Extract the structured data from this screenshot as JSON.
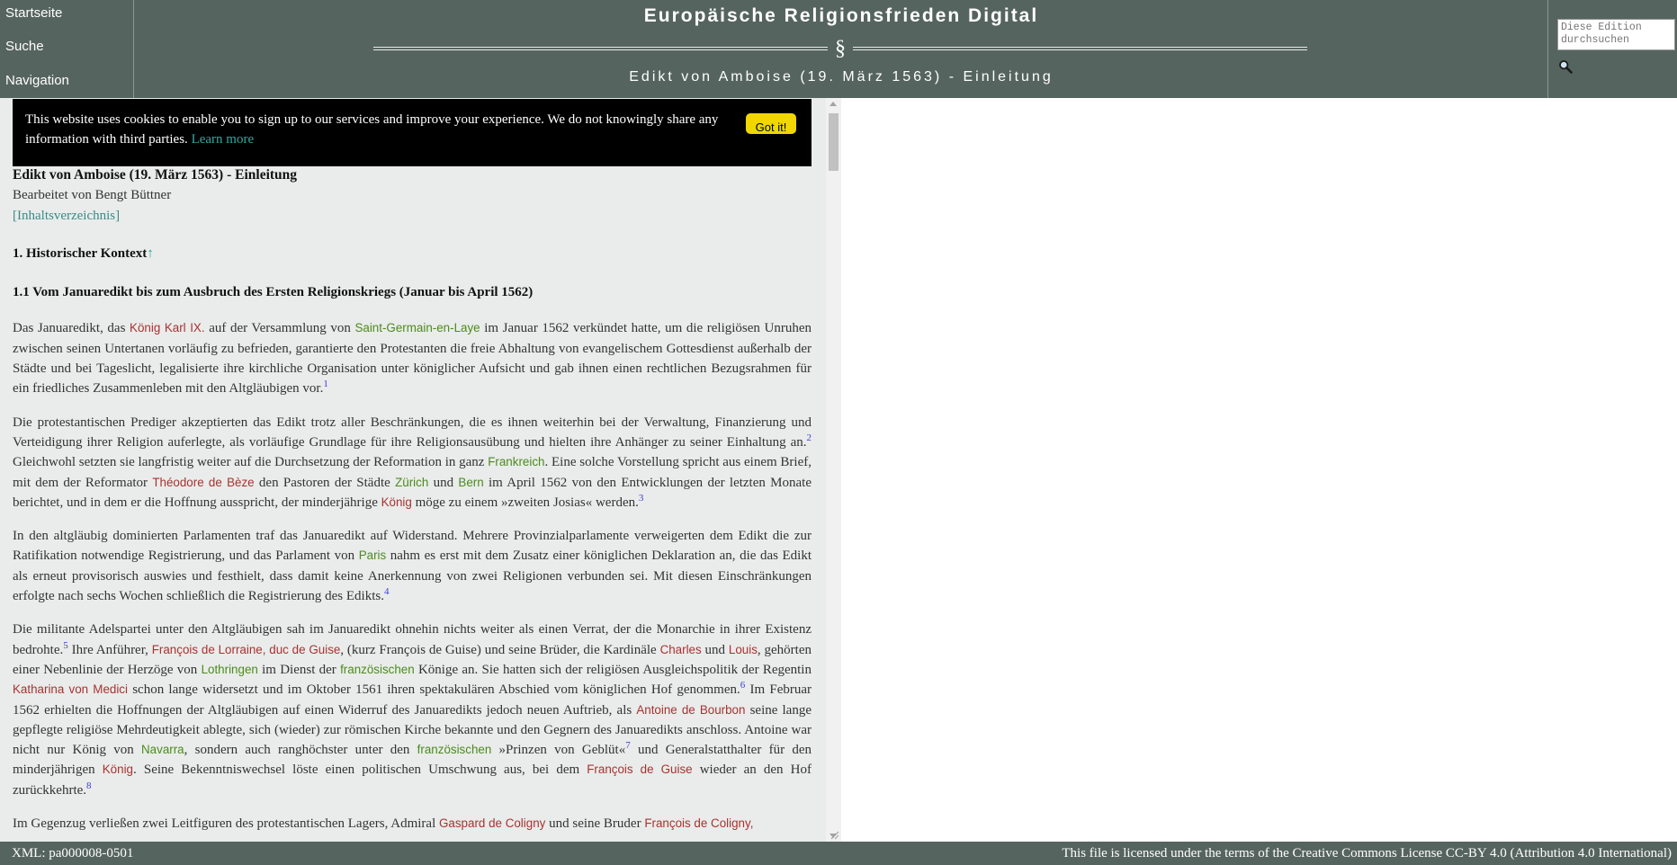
{
  "header": {
    "nav": {
      "home": "Startseite",
      "search": "Suche",
      "navigation": "Navigation"
    },
    "site_title": "Europäische Religionsfrieden Digital",
    "ornament": "§",
    "subtitle": "Edikt von Amboise (19. März 1563) - Einleitung",
    "search_placeholder": "Diese Edition durchsuchen"
  },
  "cookie_banner": {
    "text": "This website uses cookies to enable you to sign up to our services and improve your experience. We do not knowingly share any information with third parties.",
    "learn_more": "Learn more",
    "button": "Got it!"
  },
  "document": {
    "title": "Edikt von Amboise (19. März 1563) - Einleitung",
    "byline": "Bearbeitet von Bengt Büttner",
    "toc": "[Inhaltsverzeichnis]",
    "section_1": "1. Historischer Kontext",
    "section_1_arrow": "↑",
    "section_1_1": "1.1 Vom Januaredikt bis zum Ausbruch des Ersten Religionskriegs (Januar bis April 1562)",
    "paragraphs": [
      {
        "t0": "Das Januaredikt, das ",
        "p0": "König Karl IX.",
        "t1": " auf der Versammlung von ",
        "l0": "Saint-Germain-en-Laye",
        "t2": " im Januar 1562 verkündet hatte, um die religiösen Unruhen zwischen seinen Untertanen vorläufig zu befrieden, garantierte den Protestanten die freie Abhaltung von evangelischem Gottesdienst außerhalb der Städte und bei Tageslicht, legalisierte ihre kirchliche Organisation unter königlicher Aufsicht und gab ihnen einen rechtlichen Bezugsrahmen für ein friedliches Zusammenleben mit den Altgläubigen vor.",
        "f0": "1"
      },
      {
        "t0": "Die protestantischen Prediger akzeptierten das Edikt trotz aller Beschränkungen, die es ihnen weiterhin bei der Verwaltung, Finanzierung und Verteidigung ihrer Religion auferlegte, als vorläufige Grundlage für ihre Religionsausübung und hielten ihre Anhänger zu seiner Einhaltung an.",
        "f0": "2",
        "t1": " Gleichwohl setzten sie langfristig weiter auf die Durchsetzung der Reformation in ganz ",
        "l0": "Frankreich",
        "t2": ". Eine solche Vorstellung spricht aus einem Brief, mit dem der Reformator ",
        "p0": "Théodore de Bèze",
        "t3": " den Pastoren der Städte ",
        "l1": "Zürich",
        "t4": " und ",
        "l2": "Bern",
        "t5": " im April 1562 von den Entwicklungen der letzten Monate berichtet, und in dem er die Hoffnung ausspricht, der minderjährige ",
        "p1": "König",
        "t6": " möge zu einem »zweiten Josias« werden.",
        "f1": "3"
      },
      {
        "t0": "In den altgläubig dominierten Parlamenten traf das Januaredikt auf Widerstand. Mehrere Provinzialparlamente verweigerten dem Edikt die zur Ratifikation notwendige Registrierung, und das Parlament von ",
        "l0": "Paris",
        "t1": " nahm es erst mit dem Zusatz einer königlichen Deklaration an, die das Edikt als erneut provisorisch auswies und festhielt, dass damit keine Anerkennung von zwei Religionen verbunden sei. Mit diesen Einschränkungen erfolgte nach sechs Wochen schließlich die Registrierung des Edikts.",
        "f0": "4"
      },
      {
        "t0": "Die militante Adelspartei unter den Altgläubigen sah im Januaredikt ohnehin nichts weiter als einen Verrat, der die Monarchie in ihrer Existenz bedrohte.",
        "f0": "5",
        "t1": " Ihre Anführer, ",
        "p0": "François de Lorraine, duc de Guise",
        "t2": ", (kurz François de Guise) und seine Brüder, die Kardinäle ",
        "p1": "Charles",
        "t3": " und ",
        "p2": "Louis",
        "t4": ", gehörten einer Nebenlinie der Herzöge von ",
        "l0": "Lothringen",
        "t5": " im Dienst der ",
        "l1": "französischen",
        "t6": " Könige an. Sie hatten sich der religiösen Ausgleichspolitik der Regentin ",
        "p3": "Katharina von Medici",
        "t7": " schon lange widersetzt und im Oktober 1561 ihren spektakulären Abschied vom königlichen Hof genommen.",
        "f1": "6",
        "t8": " Im Februar 1562 erhielten die Hoffnungen der Altgläubigen auf einen Widerruf des Januaredikts jedoch neuen Auftrieb, als ",
        "p4": "Antoine de Bourbon",
        "t9": " seine lange gepflegte religiöse Mehrdeutigkeit ablegte, sich (wieder) zur römischen Kirche bekannte und den Gegnern des Januaredikts anschloss. Antoine war nicht nur König von ",
        "l2": "Navarra",
        "t10": ", sondern auch ranghöchster unter den ",
        "l3": "französischen",
        "t11": " »Prinzen von Geblüt«",
        "f2": "7",
        "t12": " und Generalstatthalter für den minderjährigen ",
        "p5": "König",
        "t13": ". Seine Bekenntniswechsel löste einen politischen Umschwung aus, bei dem ",
        "p6": "François de Guise",
        "t14": " wieder an den Hof zurückkehrte.",
        "f3": "8"
      },
      {
        "t0": "Im Gegenzug verließen zwei Leitfiguren des protestantischen Lagers, Admiral ",
        "p0": "Gaspard de Coligny",
        "t1": " und seine Bruder ",
        "p1": "François de Coligny,"
      }
    ]
  },
  "footer": {
    "xml": "XML: pa000008-0501",
    "license": "This file is licensed under the terms of the Creative Commons License CC-BY 4.0 (Attribution 4.0 International)"
  },
  "icons": {
    "search": "magnifier-icon"
  }
}
